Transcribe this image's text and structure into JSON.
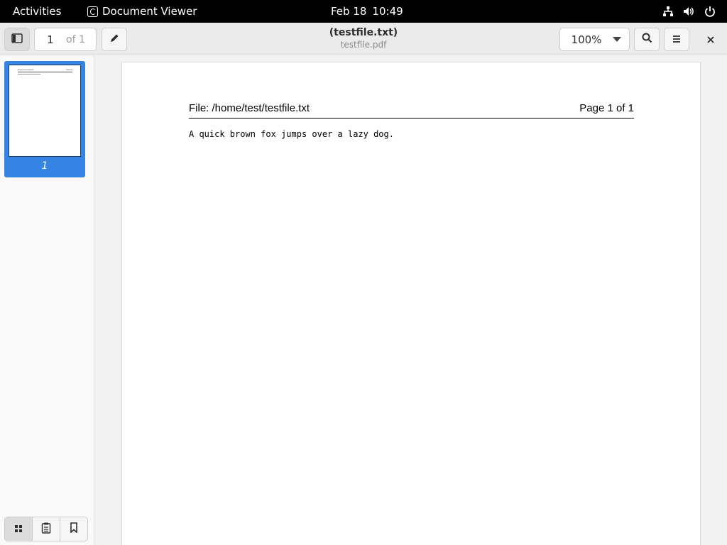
{
  "topbar": {
    "activities": "Activities",
    "app_name": "Document Viewer",
    "date": "Feb 18",
    "time": "10:49"
  },
  "header": {
    "page_current": "1",
    "page_of": "of 1",
    "title": "(testfile.txt)",
    "subtitle": "testfile.pdf",
    "zoom": "100%"
  },
  "sidebar": {
    "thumbnails": [
      {
        "label": "1"
      }
    ]
  },
  "document": {
    "header_left": "File: /home/test/testfile.txt",
    "header_right": "Page 1 of 1",
    "body": "A quick brown fox jumps over a lazy dog."
  }
}
